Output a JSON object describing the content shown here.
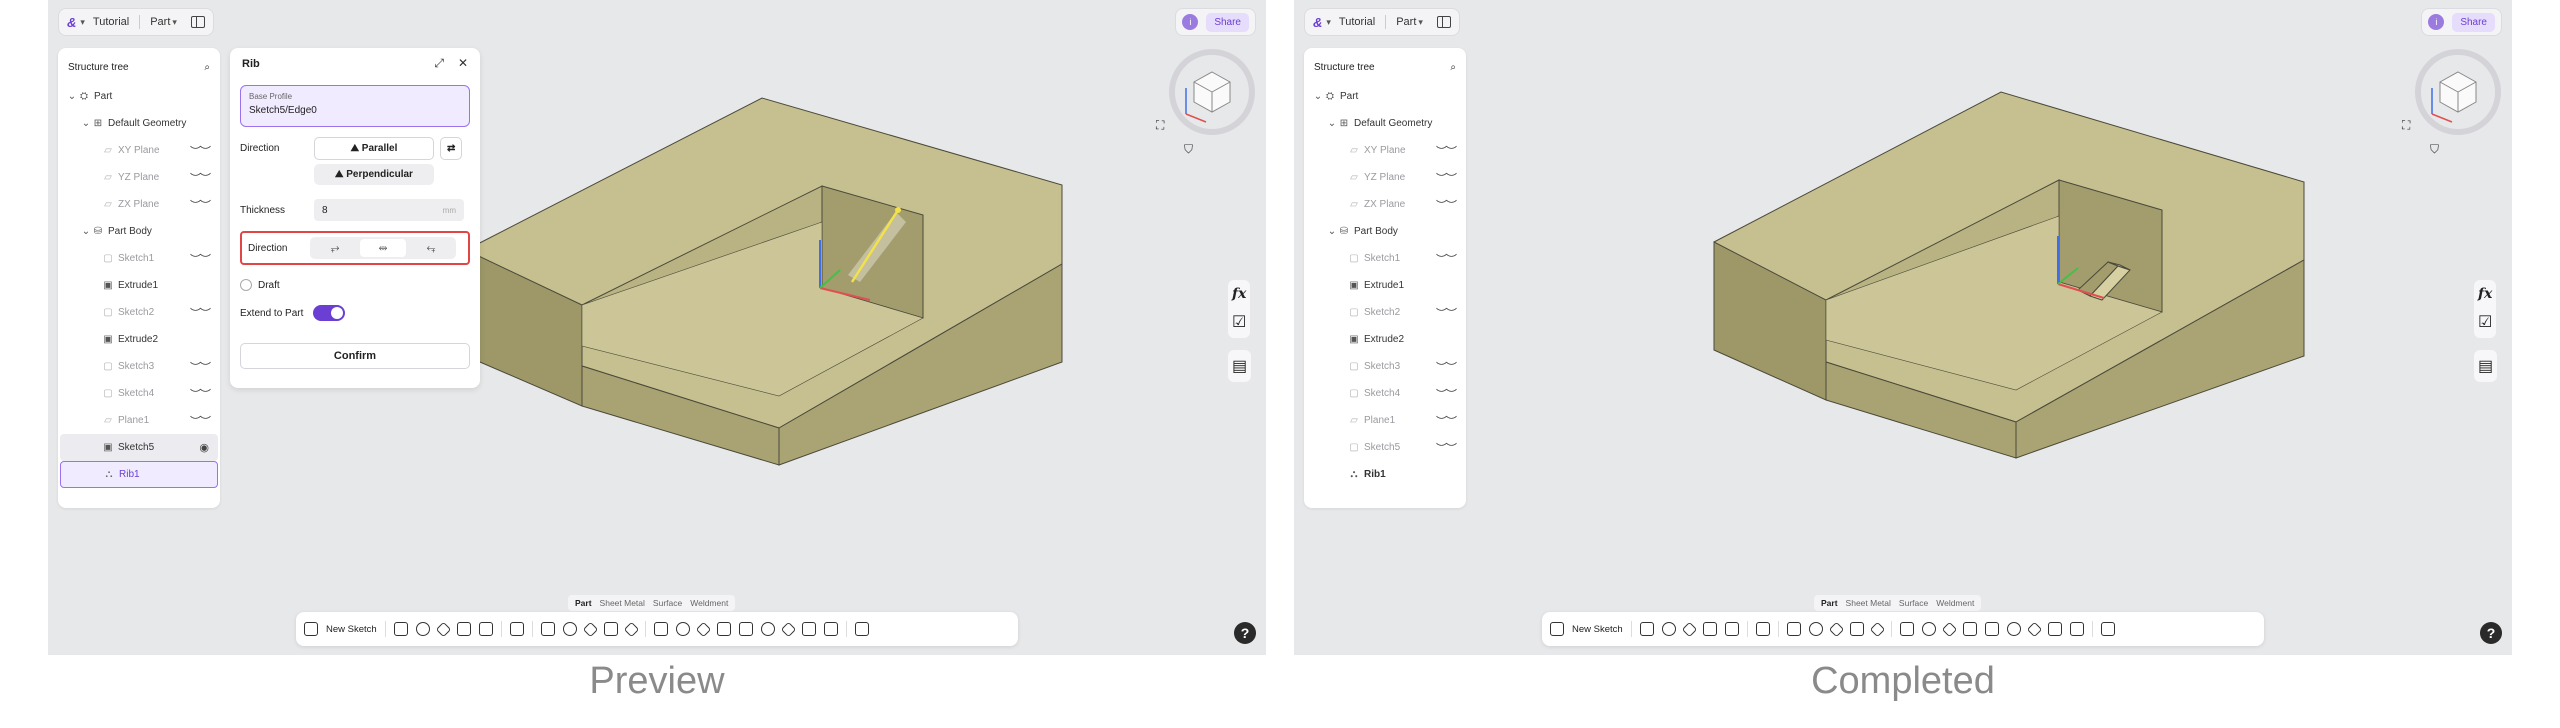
{
  "captions": {
    "left": "Preview",
    "right": "Completed"
  },
  "topbar": {
    "logo": "&",
    "crumb_tutorial": "Tutorial",
    "crumb_part": "Part"
  },
  "share_label": "Share",
  "avatar_initial": "i",
  "tree": {
    "title": "Structure tree",
    "part": "Part",
    "default_geometry": "Default Geometry",
    "xy_plane": "XY Plane",
    "yz_plane": "YZ Plane",
    "zx_plane": "ZX Plane",
    "part_body": "Part Body",
    "sketch1": "Sketch1",
    "extrude1": "Extrude1",
    "sketch2": "Sketch2",
    "extrude2": "Extrude2",
    "sketch3": "Sketch3",
    "sketch4": "Sketch4",
    "plane1": "Plane1",
    "sketch5": "Sketch5",
    "rib1": "Rib1"
  },
  "rib_panel": {
    "title": "Rib",
    "base_profile_label": "Base Profile",
    "base_profile_value": "Sketch5/Edge0",
    "direction_label": "Direction",
    "parallel": "Parallel",
    "perpendicular": "Perpendicular",
    "thickness_label": "Thickness",
    "thickness_value": "8",
    "thickness_unit": "mm",
    "direction2_label": "Direction",
    "draft_label": "Draft",
    "extend_label": "Extend to Part",
    "confirm": "Confirm"
  },
  "bottom_tabs": [
    "Part",
    "Sheet Metal",
    "Surface",
    "Weldment"
  ],
  "toolbar": {
    "new_sketch": "New Sketch"
  },
  "fx_label": "fx",
  "help_label": "?",
  "colors": {
    "accent": "#6b3fd4",
    "highlight": "#e04646",
    "solid_top": "#c6bf8f",
    "solid_side": "#a9a374"
  }
}
